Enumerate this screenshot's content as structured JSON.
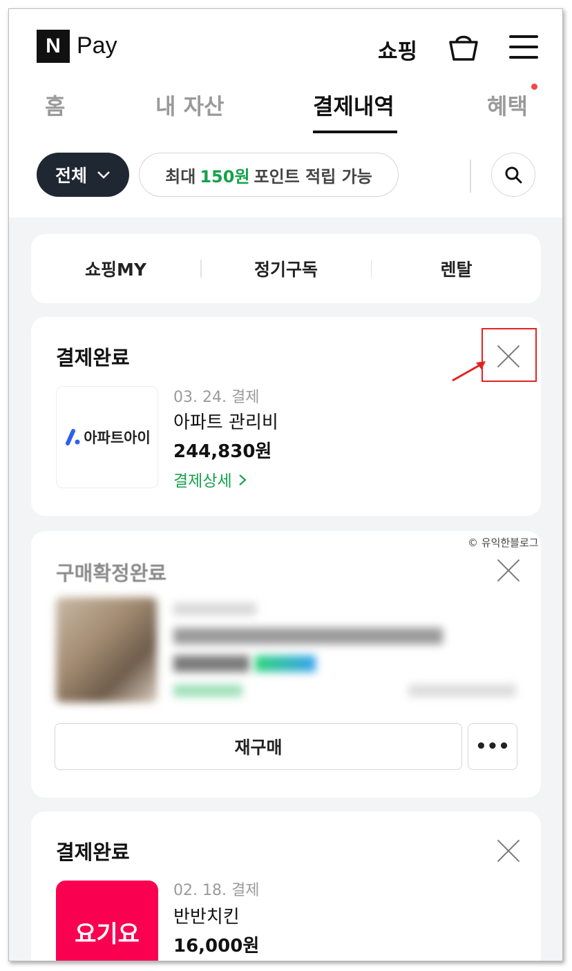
{
  "app": {
    "logo_letter": "N",
    "logo_text": "Pay",
    "shop_label": "쇼핑"
  },
  "icons": {
    "cart": "cart-icon",
    "menu": "menu-icon",
    "search": "search-icon",
    "close": "close-icon",
    "chevron": "chevron-down-icon"
  },
  "tabs": [
    {
      "label": "홈",
      "active": false
    },
    {
      "label": "내 자산",
      "active": false
    },
    {
      "label": "결제내역",
      "active": true
    },
    {
      "label": "혜택",
      "active": false
    }
  ],
  "filter": {
    "selected": "전체",
    "point_prefix": "최대",
    "point_amount": "150원",
    "point_suffix": "포인트 적립 가능"
  },
  "quick_menu": [
    "쇼핑MY",
    "정기구독",
    "렌탈"
  ],
  "orders": [
    {
      "status": "결제완료",
      "merchant_logo_text": "아파트아이",
      "date": "03. 24. 결제",
      "name": "아파트 관리비",
      "price": "244,830원",
      "detail_link": "결제상세"
    },
    {
      "status": "구매확정완료",
      "rebuy_label": "재구매",
      "more_label": "•••"
    },
    {
      "status": "결제완료",
      "merchant_logo_text": "요기요",
      "date": "02. 18. 결제",
      "name": "반반치킨",
      "price": "16,000원"
    }
  ],
  "watermark": "© 유익한블로그",
  "colors": {
    "accent_green": "#15a24b",
    "dark_pill": "#1f2733",
    "notice_red": "#f0464b",
    "yogiyo_red": "#fa0050",
    "annotation_red": "#e32020"
  }
}
